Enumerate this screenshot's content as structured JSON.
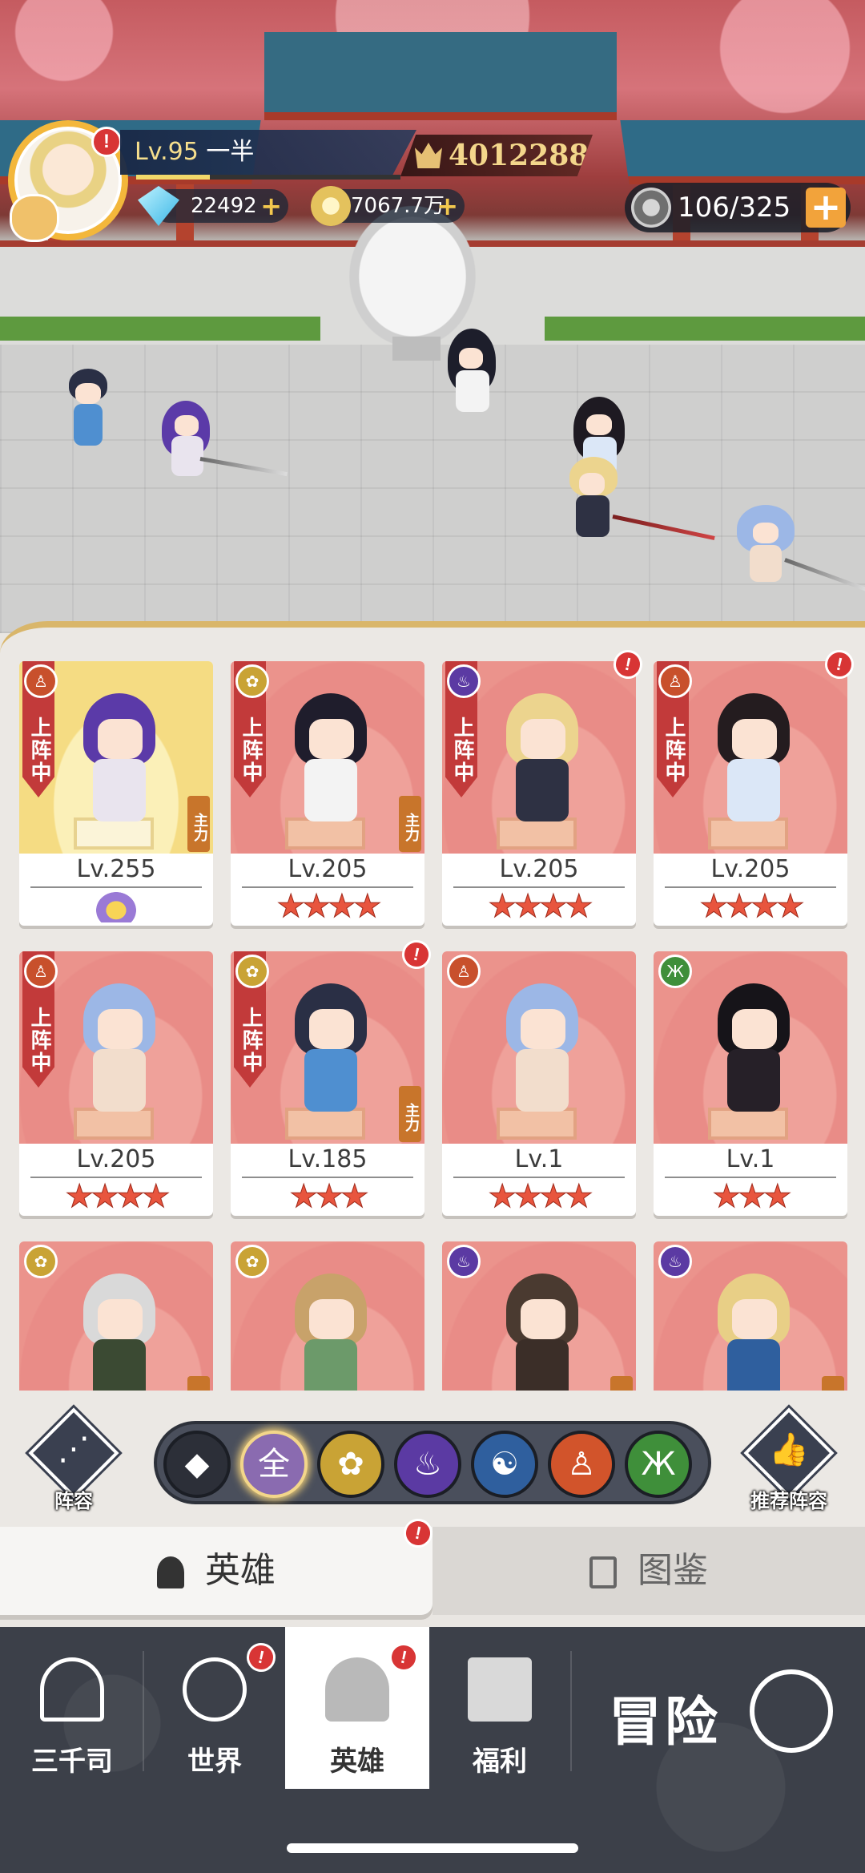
{
  "player": {
    "level": "Lv.95",
    "name": "一半",
    "power": "4012288",
    "exp_fraction": 0.28,
    "gems": "22492",
    "gold": "7067.7万",
    "stamina": "106/325",
    "alert": "!"
  },
  "heroes": [
    {
      "level": "Lv.255",
      "status": "上阵中",
      "role": "主力",
      "rank": "lotus",
      "stars": "",
      "theme": "gold",
      "emblem": "monk",
      "alert": ""
    },
    {
      "level": "Lv.205",
      "status": "上阵中",
      "role": "主力",
      "rank": "stars",
      "stars": "★★★★",
      "theme": "red",
      "emblem": "lotus",
      "alert": ""
    },
    {
      "level": "Lv.205",
      "status": "上阵中",
      "role": "",
      "rank": "stars",
      "stars": "★★★★",
      "theme": "red",
      "emblem": "flame",
      "alert": "!"
    },
    {
      "level": "Lv.205",
      "status": "上阵中",
      "role": "",
      "rank": "stars",
      "stars": "★★★★",
      "theme": "red",
      "emblem": "monk",
      "alert": "!"
    },
    {
      "level": "Lv.205",
      "status": "上阵中",
      "role": "",
      "rank": "stars",
      "stars": "★★★★",
      "theme": "red",
      "emblem": "monk",
      "alert": ""
    },
    {
      "level": "Lv.185",
      "status": "上阵中",
      "role": "主力",
      "rank": "stars",
      "stars": "★★★",
      "theme": "red",
      "emblem": "lotus",
      "alert": "!"
    },
    {
      "level": "Lv.1",
      "status": "",
      "role": "",
      "rank": "stars",
      "stars": "★★★★",
      "theme": "red",
      "emblem": "monk",
      "alert": ""
    },
    {
      "level": "Lv.1",
      "status": "",
      "role": "",
      "rank": "stars",
      "stars": "★★★",
      "theme": "red",
      "emblem": "dna",
      "alert": ""
    },
    {
      "level": "",
      "status": "",
      "role": "主",
      "rank": "",
      "stars": "",
      "theme": "red",
      "emblem": "lotus",
      "alert": ""
    },
    {
      "level": "",
      "status": "",
      "role": "",
      "rank": "",
      "stars": "",
      "theme": "red",
      "emblem": "lotus",
      "alert": ""
    },
    {
      "level": "",
      "status": "",
      "role": "主",
      "rank": "",
      "stars": "",
      "theme": "red",
      "emblem": "flame",
      "alert": ""
    },
    {
      "level": "",
      "status": "",
      "role": "主",
      "rank": "",
      "stars": "",
      "theme": "red",
      "emblem": "flame",
      "alert": ""
    }
  ],
  "filters": {
    "formation_label": "阵容",
    "recommend_label": "推荐阵容",
    "chips": [
      {
        "name": "role-filter-chip",
        "glyph": "◆",
        "color": "#2c2f38"
      },
      {
        "name": "all-filter-chip",
        "glyph": "全",
        "color": "#8a6bb0"
      },
      {
        "name": "lotus-filter-chip",
        "glyph": "✿",
        "color": "#c9a335"
      },
      {
        "name": "flame-filter-chip",
        "glyph": "♨",
        "color": "#5b3aa3"
      },
      {
        "name": "yinyang-filter-chip",
        "glyph": "☯",
        "color": "#2f5f9e"
      },
      {
        "name": "monk-filter-chip",
        "glyph": "♙",
        "color": "#d2542b"
      },
      {
        "name": "dna-filter-chip",
        "glyph": "Ж",
        "color": "#3f8f3a"
      }
    ],
    "selected": 1
  },
  "subtabs": {
    "heroes": "英雄",
    "codex": "图鉴",
    "alert": "!"
  },
  "nav": {
    "items": [
      {
        "label": "三千司",
        "icon": "temple-icon",
        "alert": ""
      },
      {
        "label": "世界",
        "icon": "planet-icon",
        "alert": "!"
      },
      {
        "label": "英雄",
        "icon": "hero-icon",
        "alert": "!"
      },
      {
        "label": "福利",
        "icon": "gift-icon",
        "alert": ""
      }
    ],
    "active": 2,
    "adventure": "冒险"
  },
  "colors": {
    "alert_red": "#d83535",
    "star_red": "#e8553e",
    "nav_bg": "#3c4049",
    "gold_accent": "#f3d68a"
  }
}
